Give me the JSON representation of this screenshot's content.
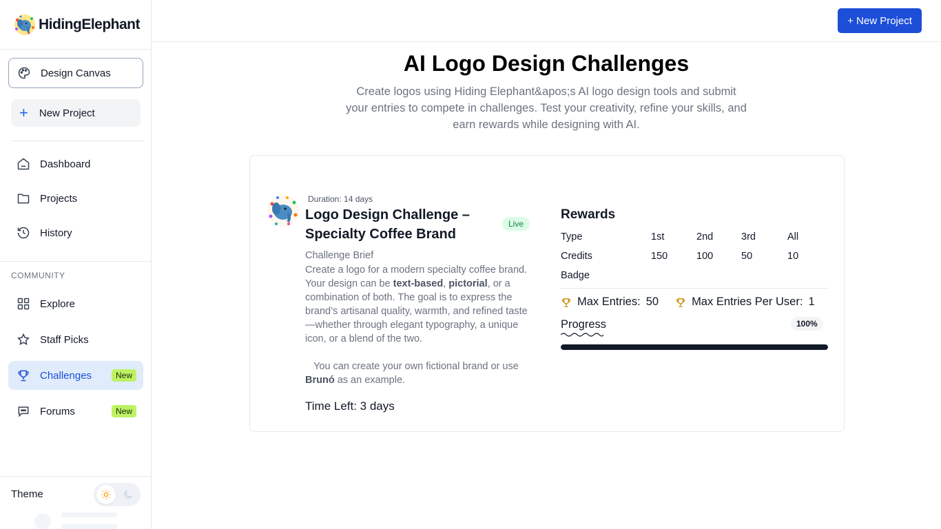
{
  "brand": {
    "name": "HidingElephant"
  },
  "sidebar": {
    "design_canvas": "Design Canvas",
    "new_project": "New Project",
    "nav": [
      {
        "label": "Dashboard",
        "icon": "home-icon"
      },
      {
        "label": "Projects",
        "icon": "folder-icon"
      },
      {
        "label": "History",
        "icon": "history-icon"
      }
    ],
    "community_heading": "COMMUNITY",
    "community": [
      {
        "label": "Explore",
        "icon": "grid-icon",
        "badge": ""
      },
      {
        "label": "Staff Picks",
        "icon": "star-icon",
        "badge": ""
      },
      {
        "label": "Challenges",
        "icon": "trophy-icon",
        "badge": "New",
        "active": true
      },
      {
        "label": "Forums",
        "icon": "chat-icon",
        "badge": "New"
      }
    ],
    "theme_label": "Theme"
  },
  "header": {
    "new_project_button": "+ New Project"
  },
  "page": {
    "title": "AI Logo Design Challenges",
    "description": "Create logos using Hiding Elephant&apos;s AI logo design tools and submit your entries to compete in challenges. Test your creativity, refine your skills, and earn rewards while designing with AI."
  },
  "challenge": {
    "duration": "Duration: 14 days",
    "title": "Logo Design Challenge – Specialty Coffee Brand",
    "status": "Live",
    "brief_heading": "Challenge Brief",
    "brief_pre": "Create a logo for a modern specialty coffee brand. Your design can be ",
    "brief_bold1": "text-based",
    "brief_comma": ", ",
    "brief_bold2": "pictorial",
    "brief_post": ", or a combination of both. The goal is to express the brand’s artisanal quality, warmth, and refined taste—whether through elegant typography, a unique icon, or a blend of the two.",
    "brief2_pre": "You can create your own fictional brand or use ",
    "brief2_bold": "Brunó",
    "brief2_post": " as an example.",
    "time_left": "Time Left: 3 days",
    "rewards": {
      "title": "Rewards",
      "header": {
        "label": "Type",
        "c1": "1st",
        "c2": "2nd",
        "c3": "3rd",
        "c4": "All"
      },
      "credits": {
        "label": "Credits",
        "c1": "150",
        "c2": "100",
        "c3": "50",
        "c4": "10"
      },
      "badge": {
        "label": "Badge"
      }
    },
    "max_entries_label": "Max Entries:",
    "max_entries": "50",
    "max_per_user_label": "Max Entries Per User:",
    "max_per_user": "1",
    "progress_label": "Progress",
    "progress_percent_text": "100%",
    "progress_value": 1.0
  },
  "colors": {
    "accent": "#1d4ed8",
    "live": "#15803d",
    "new_badge": "#bef264",
    "trophy": "#ca8a04"
  }
}
